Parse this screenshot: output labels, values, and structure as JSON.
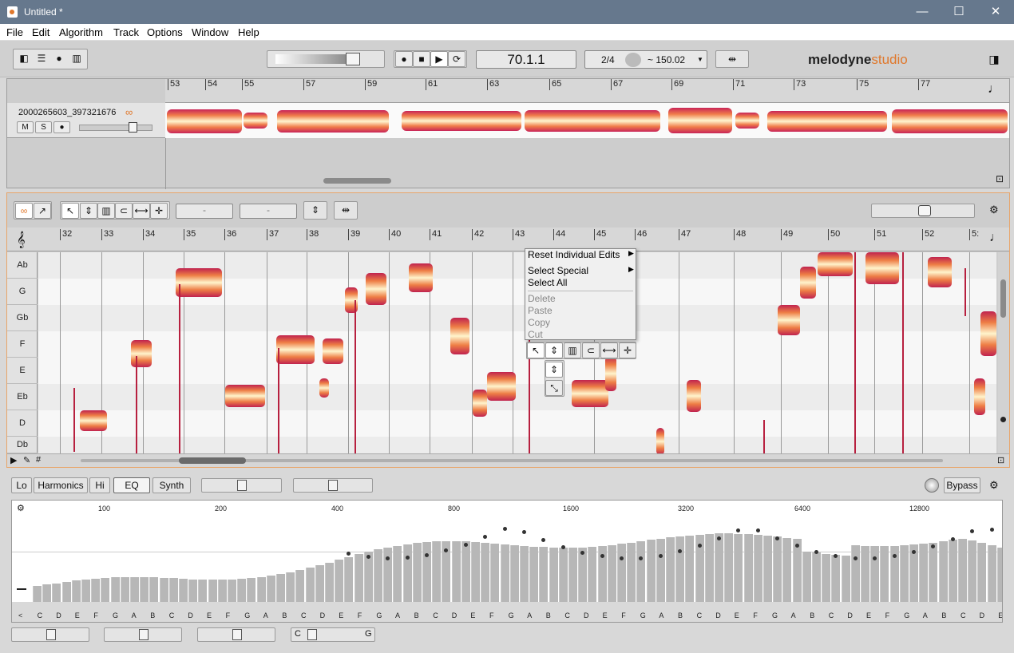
{
  "window": {
    "title": "Untitled *",
    "min": "—",
    "max": "☐",
    "close": "✕"
  },
  "menu": [
    "File",
    "Edit",
    "Algorithm",
    "Track",
    "Options",
    "Window",
    "Help"
  ],
  "toolbar": {
    "position": "70.1.1",
    "signature": "2/4",
    "tempo": "~ 150.02",
    "brand": "melodyne",
    "edition": "studio"
  },
  "overview": {
    "ruler": [
      "53",
      "54",
      "55",
      "57",
      "59",
      "61",
      "63",
      "65",
      "67",
      "69",
      "71",
      "73",
      "75",
      "77"
    ],
    "track_name": "2000265603_397321676",
    "buttons": [
      "M",
      "S",
      "●"
    ]
  },
  "editor": {
    "field1": "-",
    "field2": "-",
    "ruler": [
      "32",
      "33",
      "34",
      "35",
      "36",
      "37",
      "38",
      "39",
      "40",
      "41",
      "42",
      "43",
      "44",
      "45",
      "46",
      "47",
      "48",
      "49",
      "50",
      "51",
      "52",
      "5:"
    ],
    "keys": [
      "Ab",
      "G",
      "Gb",
      "F",
      "E",
      "Eb",
      "D",
      "Db"
    ]
  },
  "context_menu": {
    "items": [
      {
        "label": "Reset Individual Edits",
        "disabled": false,
        "sub": true
      },
      {
        "label": "Select Special",
        "disabled": false,
        "sub": true
      },
      {
        "label": "Select All",
        "disabled": false,
        "sub": false
      },
      {
        "label": "Delete",
        "disabled": true,
        "sub": false
      },
      {
        "label": "Paste",
        "disabled": true,
        "sub": false
      },
      {
        "label": "Copy",
        "disabled": true,
        "sub": false
      },
      {
        "label": "Cut",
        "disabled": true,
        "sub": false
      }
    ]
  },
  "sound_editor": {
    "tabs": [
      "Lo",
      "Harmonics",
      "Hi",
      "EQ",
      "Synth"
    ],
    "selected_tab": "EQ",
    "bypass": "Bypass",
    "freqs": [
      "100",
      "200",
      "400",
      "800",
      "1600",
      "3200",
      "6400",
      "12800"
    ],
    "notes": [
      "<",
      "C",
      "D",
      "E",
      "F",
      "G",
      "A",
      "B",
      "C",
      "D",
      "E",
      "F",
      "G",
      "A",
      "B",
      "C",
      "D",
      "E",
      "F",
      "G",
      "A",
      "B",
      "C",
      "D",
      "E",
      "F",
      "G",
      "A",
      "B",
      "C",
      "D",
      "E",
      "F",
      "G",
      "A",
      "B",
      "C",
      "D",
      "E",
      "F",
      "G",
      "A",
      "B",
      "C",
      "D",
      "E",
      "F",
      "G",
      "A",
      "B",
      "C",
      "D",
      "E"
    ],
    "range_c": "C",
    "range_g": "G"
  },
  "colors": {
    "accent": "#e0782c",
    "blob_edge": "#c0234f",
    "blob_core": "#fff4cc"
  }
}
